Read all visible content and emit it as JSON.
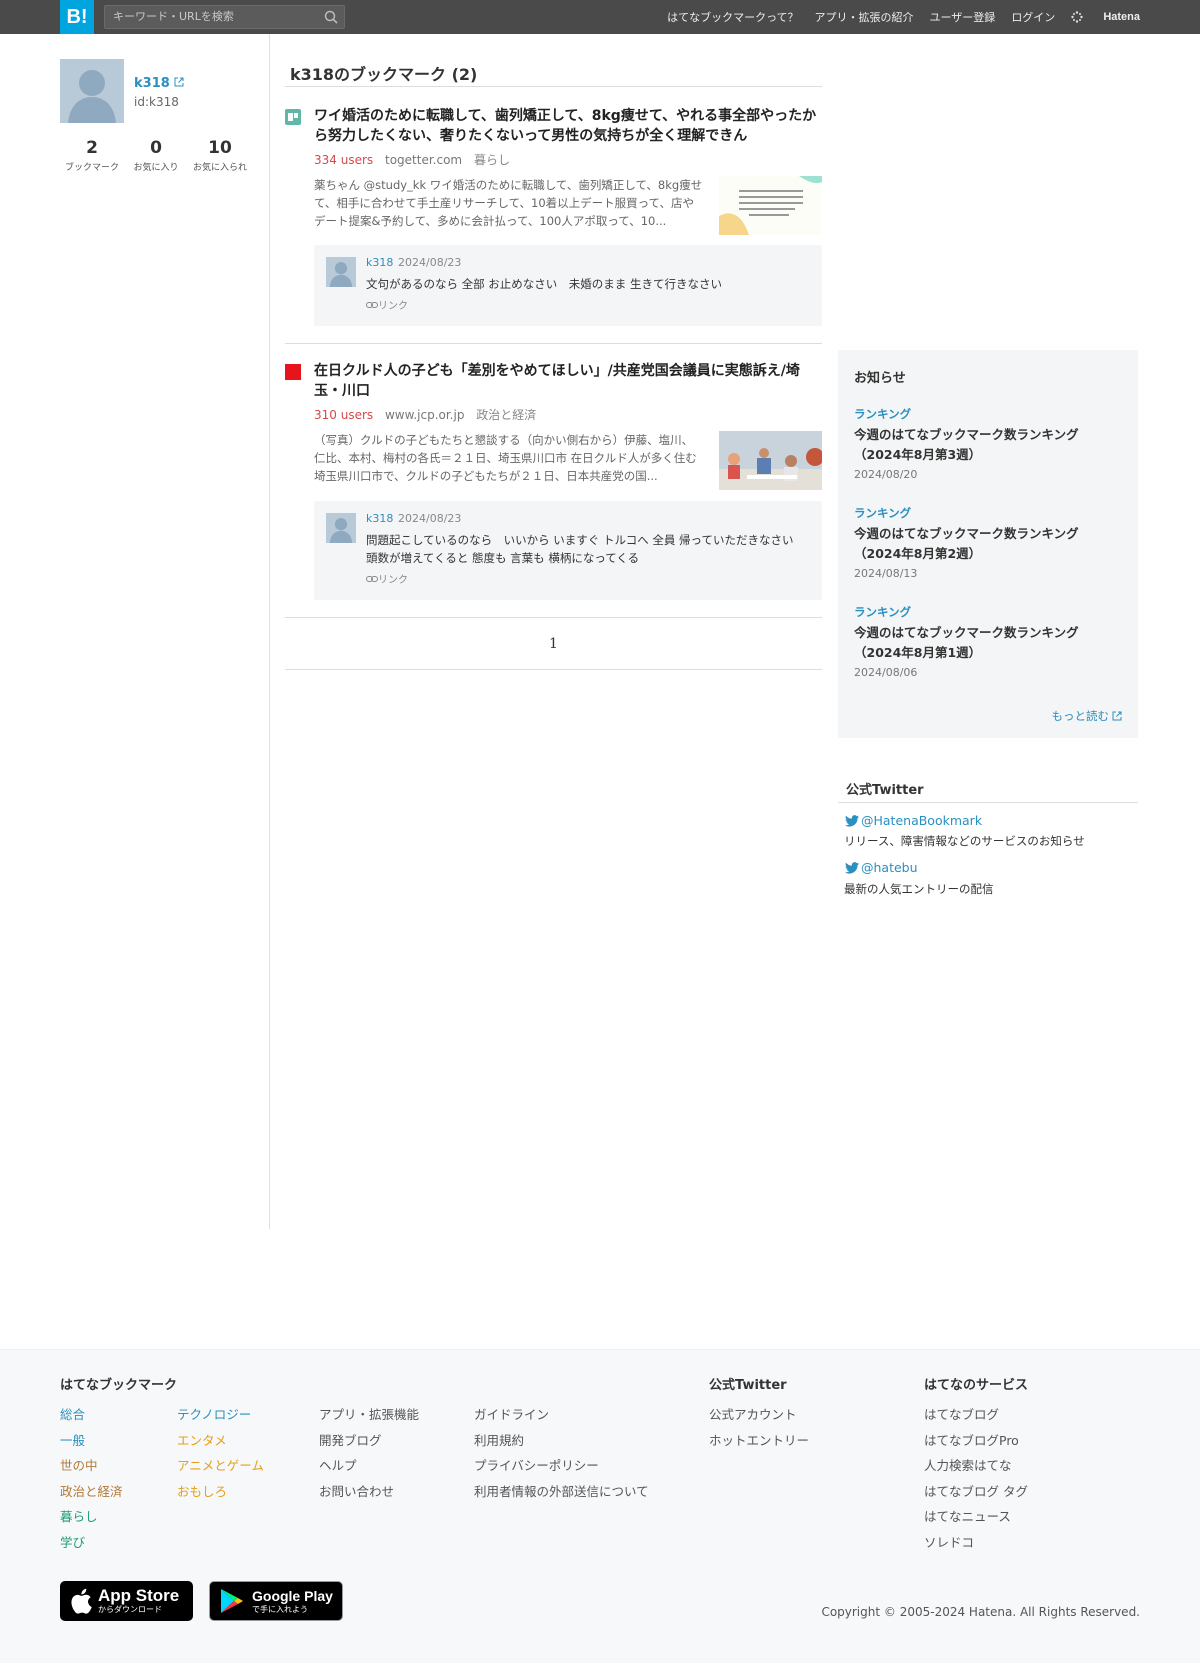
{
  "header": {
    "logo": "B!",
    "search_placeholder": "キーワード・URLを検索",
    "nav": [
      "はてなブックマークって？",
      "アプリ・拡張の紹介",
      "ユーザー登録",
      "ログイン"
    ],
    "brand": "Hatena"
  },
  "profile": {
    "name": "k318",
    "id": "id:k318",
    "stats": [
      {
        "num": "2",
        "label": "ブックマーク"
      },
      {
        "num": "0",
        "label": "お気に入り"
      },
      {
        "num": "10",
        "label": "お気に入られ"
      }
    ]
  },
  "main": {
    "title": "k318のブックマーク (2)",
    "entries": [
      {
        "title": "ワイ婚活のために転職して、歯列矯正して、8kg痩せて、やれる事全部やったから努力したくない、奢りたくないって男性の気持ちが全く理解できん",
        "users": "334 users",
        "domain": "togetter.com",
        "category": "暮らし",
        "desc": "薬ちゃん @study_kk ワイ婚活のために転職して、歯列矯正して、8kg痩せて、相手に合わせて手土産リサーチして、10着以上デート服買って、店やデート提案&予約して、多めに会計払って、100人アポ取って、10...",
        "comment_user": "k318",
        "comment_date": "2024/08/23",
        "comment": "文句があるのなら 全部 お止めなさい　未婚のまま 生きて行きなさい",
        "link_label": "リンク"
      },
      {
        "title": "在日クルド人の子ども「差別をやめてほしい」/共産党国会議員に実態訴え/埼玉・川口",
        "users": "310 users",
        "domain": "www.jcp.or.jp",
        "category": "政治と経済",
        "desc": "（写真）クルドの子どもたちと懇談する（向かい側右から）伊藤、塩川、仁比、本村、梅村の各氏＝２１日、埼玉県川口市 在日クルド人が多く住む埼玉県川口市で、クルドの子どもたちが２１日、日本共産党の国...",
        "comment_user": "k318",
        "comment_date": "2024/08/23",
        "comment": "問題起こしているのなら　いいから いますぐ トルコへ 全員 帰っていただきなさい　頭数が増えてくると 態度も 言葉も 横柄になってくる",
        "link_label": "リンク"
      }
    ],
    "page": "1"
  },
  "notice": {
    "title": "お知らせ",
    "items": [
      {
        "tag": "ランキング",
        "text": "今週のはてなブックマーク数ランキング（2024年8月第3週）",
        "date": "2024/08/20"
      },
      {
        "tag": "ランキング",
        "text": "今週のはてなブックマーク数ランキング（2024年8月第2週）",
        "date": "2024/08/13"
      },
      {
        "tag": "ランキング",
        "text": "今週のはてなブックマーク数ランキング（2024年8月第1週）",
        "date": "2024/08/06"
      }
    ],
    "more": "もっと読む"
  },
  "twitter": {
    "title": "公式Twitter",
    "accounts": [
      {
        "handle": "@HatenaBookmark",
        "desc": "リリース、障害情報などのサービスのお知らせ"
      },
      {
        "handle": "@hatebu",
        "desc": "最新の人気エントリーの配信"
      }
    ]
  },
  "footer": {
    "head_bookmark": "はてなブックマーク",
    "categories_a": [
      "総合",
      "一般",
      "世の中",
      "政治と経済",
      "暮らし",
      "学び"
    ],
    "categories_b": [
      "テクノロジー",
      "エンタメ",
      "アニメとゲーム",
      "おもしろ"
    ],
    "links_a": [
      "アプリ・拡張機能",
      "開発ブログ",
      "ヘルプ",
      "お問い合わせ"
    ],
    "links_b": [
      "ガイドライン",
      "利用規約",
      "プライバシーポリシー",
      "利用者情報の外部送信について"
    ],
    "head_twitter": "公式Twitter",
    "twitter_links": [
      "公式アカウント",
      "ホットエントリー"
    ],
    "head_services": "はてなのサービス",
    "services": [
      "はてなブログ",
      "はてなブログPro",
      "人力検索はてな",
      "はてなブログ タグ",
      "はてなニュース",
      "ソレドコ"
    ],
    "appstore_big": "App Store",
    "appstore_small": "からダウンロード",
    "googleplay_big": "Google Play",
    "googleplay_small": "で手に入れよう",
    "copyright": "Copyright © 2005-2024 Hatena. All Rights Reserved."
  },
  "colors": {
    "brand_blue": "#00a4de",
    "link_blue": "#2b8fc0",
    "users_red": "#d7484b",
    "cat_general": "#2b8fc0",
    "cat_world": "#b07a3b",
    "cat_life": "#1b9e77",
    "cat_ent": "#e5a019"
  }
}
